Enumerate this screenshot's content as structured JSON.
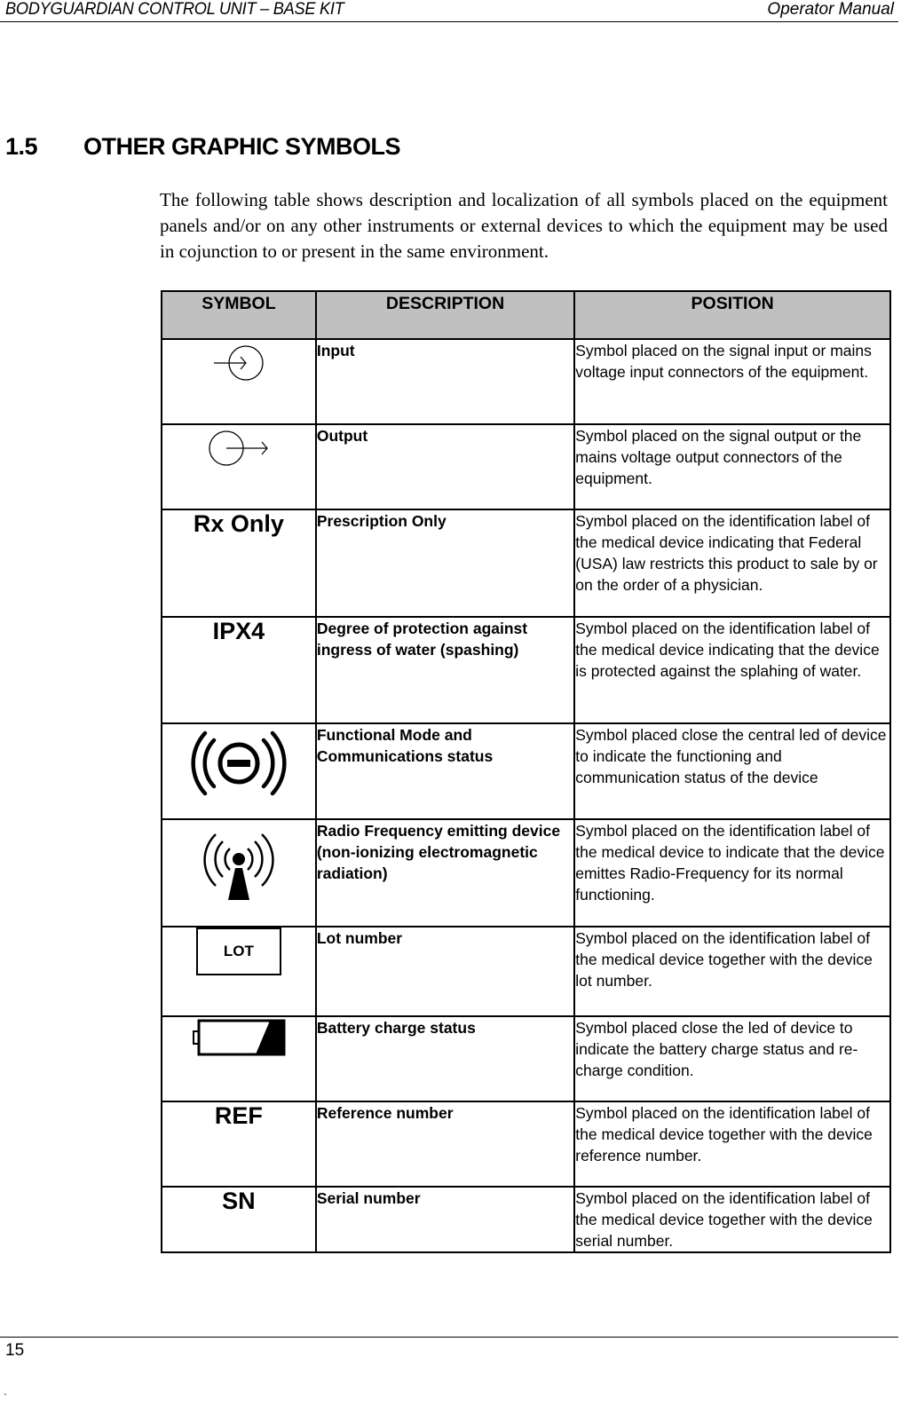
{
  "header": {
    "left": "BODYGUARDIAN CONTROL UNIT – BASE KIT",
    "right": "Operator Manual"
  },
  "section": {
    "number": "1.5",
    "title": "OTHER GRAPHIC SYMBOLS",
    "intro": "The following table shows description and localization of all symbols placed on the equipment panels and/or on any other instruments or external devices to which the equipment may be used in cojunction to or present in the same environment."
  },
  "table": {
    "headers": [
      "SYMBOL",
      "DESCRIPTION",
      "POSITION"
    ],
    "rows": [
      {
        "symbol_icon": "input-connector-icon",
        "symbol_text": "",
        "description": "Input",
        "position": "Symbol placed on the signal input or mains voltage input connectors of the equipment."
      },
      {
        "symbol_icon": "output-connector-icon",
        "symbol_text": "",
        "description": "Output",
        "position": "Symbol placed on the signal output or the mains voltage output connectors of the equipment."
      },
      {
        "symbol_icon": "",
        "symbol_text": "Rx Only",
        "description": "Prescription Only",
        "position": "Symbol placed on the identification label of the medical device indicating that Federal (USA) law restricts this product to sale by or on the order of a physician."
      },
      {
        "symbol_icon": "",
        "symbol_text": "IPX4",
        "description": "Degree of protection against ingress of water (spashing)",
        "position": "Symbol placed on the identification label of the medical device indicating that the device is protected against the splahing of water."
      },
      {
        "symbol_icon": "functional-mode-icon",
        "symbol_text": "",
        "description": "Functional Mode and Communications status",
        "position": "Symbol placed close the central led of device to indicate the functioning and communication status of the device"
      },
      {
        "symbol_icon": "radio-frequency-icon",
        "symbol_text": "",
        "description": "Radio Frequency emitting device (non-ionizing electromagnetic radiation)",
        "position": "Symbol placed on the identification label of the medical device to indicate that the device emittes Radio-Frequency for its normal functioning."
      },
      {
        "symbol_icon": "lot-icon",
        "symbol_text": "LOT",
        "description": "Lot number",
        "position": "Symbol placed on the identification label of the medical device together with the device lot number."
      },
      {
        "symbol_icon": "battery-icon",
        "symbol_text": "",
        "description": "Battery charge status",
        "position": "Symbol placed close the led of device to indicate the battery charge status and re-charge condition."
      },
      {
        "symbol_icon": "",
        "symbol_text": "REF",
        "description": "Reference number",
        "position": "Symbol placed on the identification label of the medical device together with the device reference number."
      },
      {
        "symbol_icon": "",
        "symbol_text": "SN",
        "description": "Serial number",
        "position": "Symbol placed on the identification label of the medical device together with the device serial number."
      }
    ]
  },
  "footer": {
    "page_number": "15",
    "stray_mark": "`"
  }
}
